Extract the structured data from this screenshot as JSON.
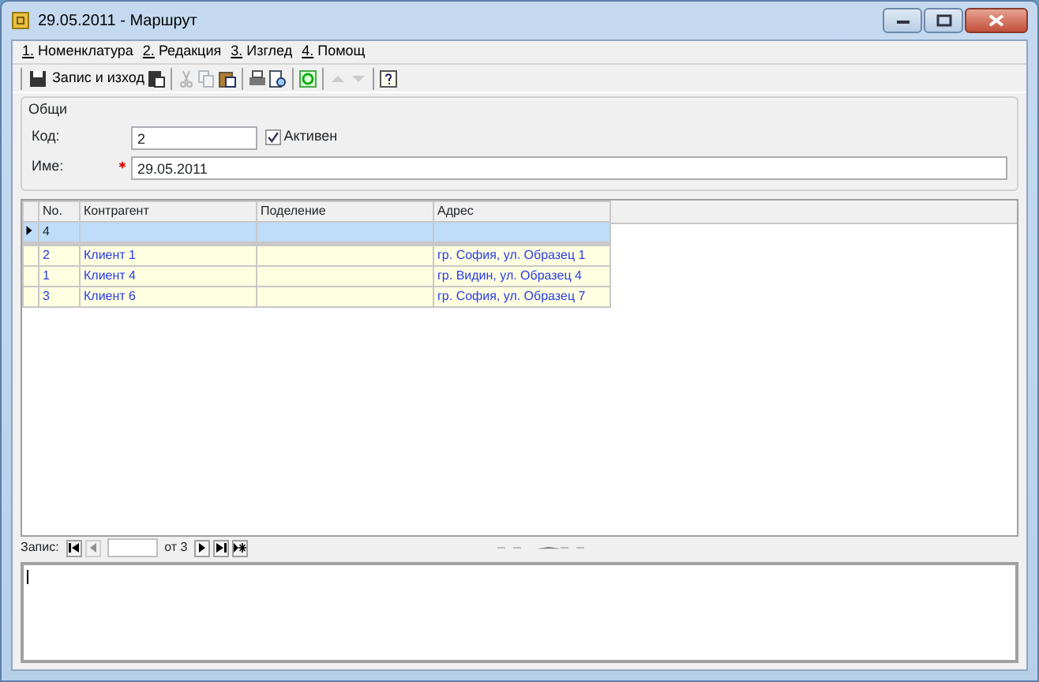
{
  "window": {
    "title": "29.05.2011 - Маршрут"
  },
  "menu": [
    "1. Номенклатура",
    "2. Редакция",
    "3. Изглед",
    "4. Помощ"
  ],
  "toolbar": [
    {
      "kind": "button",
      "label": "Запис и изход",
      "disabled": false
    },
    {
      "kind": "icon",
      "disabled": false
    },
    {
      "kind": "separator"
    },
    {
      "kind": "icon",
      "disabled": true
    },
    {
      "kind": "icon",
      "disabled": true
    },
    {
      "kind": "icon",
      "disabled": false
    },
    {
      "kind": "separator"
    },
    {
      "kind": "icon",
      "disabled": false
    },
    {
      "kind": "icon",
      "disabled": false
    },
    {
      "kind": "separator"
    },
    {
      "kind": "icon",
      "disabled": false
    },
    {
      "kind": "separator"
    },
    {
      "kind": "icon",
      "disabled": true
    },
    {
      "kind": "icon",
      "disabled": true
    },
    {
      "kind": "separator"
    },
    {
      "kind": "icon",
      "disabled": false
    }
  ],
  "general": {
    "title": "Общи",
    "code_label": "Код:",
    "code": "2",
    "active_label": "Активен",
    "active": true,
    "name_label": "Име:",
    "required": true,
    "name": "29.05.2011"
  },
  "table": {
    "columns": [
      "No.",
      "Контрагент",
      "Поделение",
      "Адрес"
    ],
    "rows": [
      {
        "kind": "new",
        "selected": true,
        "cells": [
          "4",
          "",
          "",
          ""
        ]
      },
      {
        "kind": "data",
        "selected": false,
        "cells": [
          "2",
          "Клиент 1",
          "",
          "гр. София, ул. Образец 1"
        ]
      },
      {
        "kind": "data",
        "selected": false,
        "cells": [
          "1",
          "Клиент 4",
          "",
          "гр. Видин, ул. Образец 4"
        ]
      },
      {
        "kind": "data",
        "selected": false,
        "cells": [
          "3",
          "Клиент 6",
          "",
          "гр. София, ул. Образец 7"
        ]
      }
    ]
  },
  "navigator": {
    "label": "Запис:",
    "of": "от 3",
    "prev_disabled": true
  }
}
